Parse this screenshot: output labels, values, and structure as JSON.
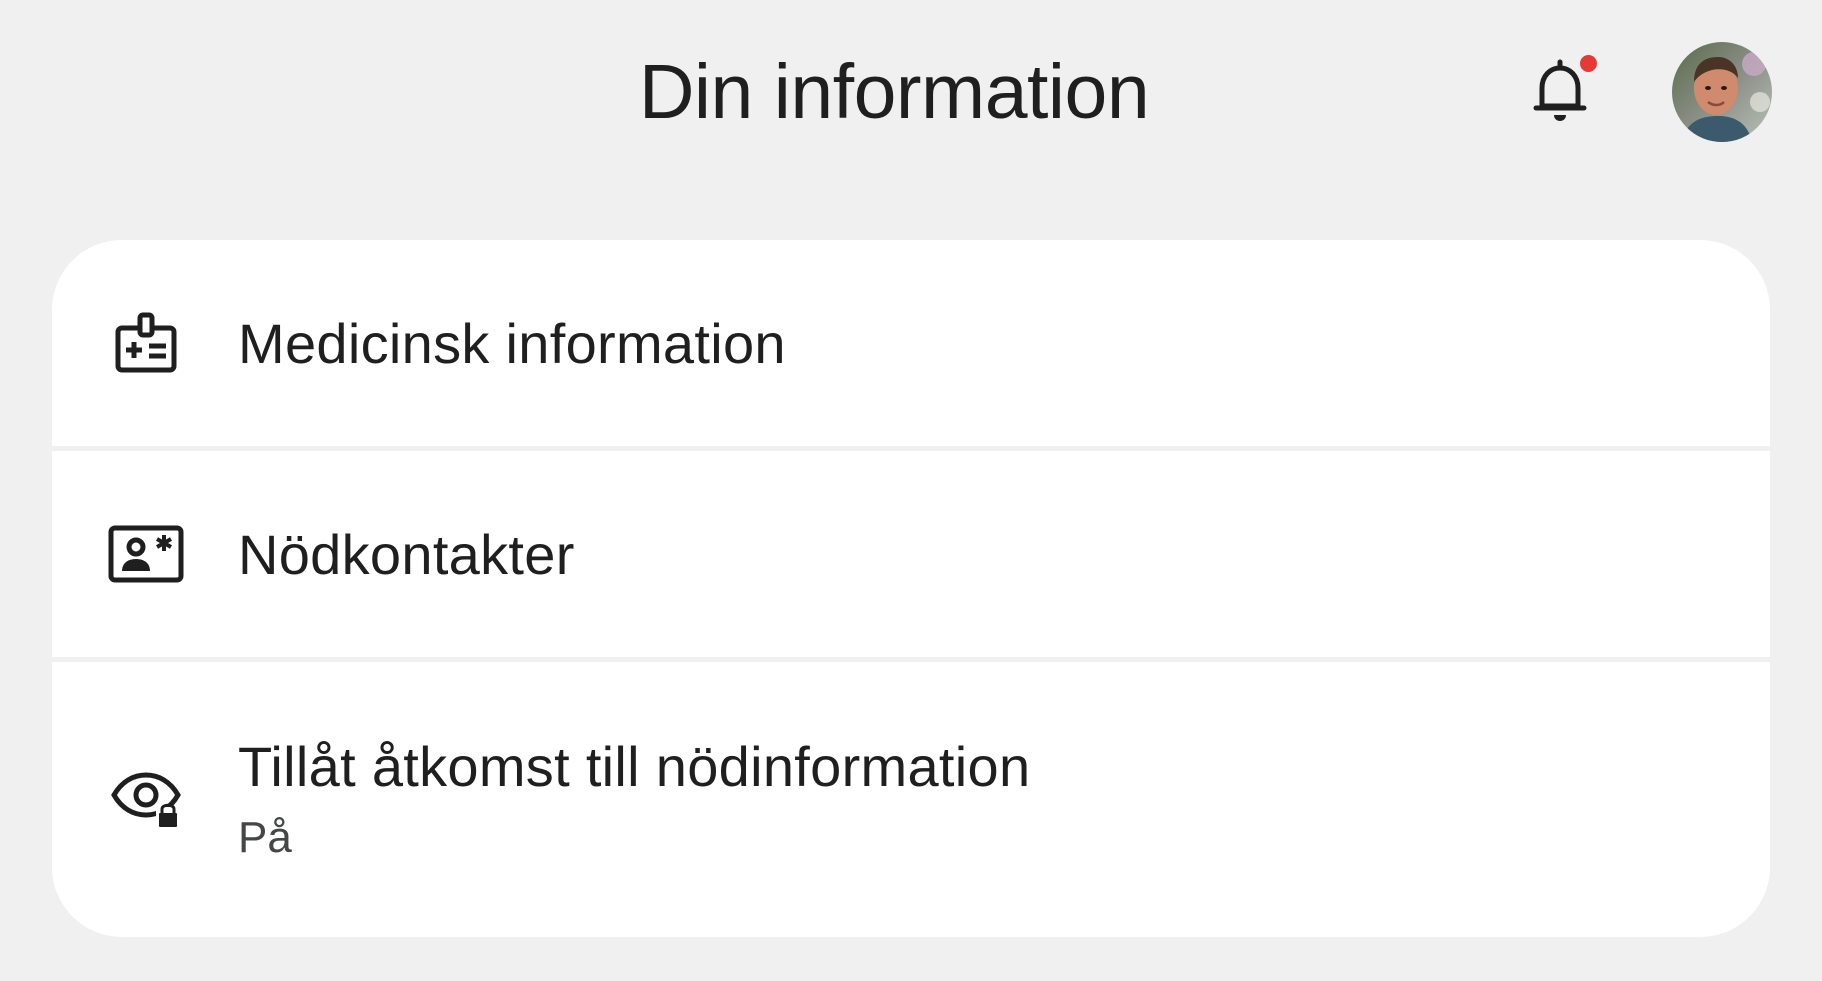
{
  "header": {
    "title": "Din information",
    "notifications_icon": "bell-icon",
    "notification_dot_color": "#e53935",
    "avatar_icon": "account-avatar"
  },
  "list": {
    "items": [
      {
        "label": "Medicinsk information",
        "icon": "medical-id-badge-icon"
      },
      {
        "label": "Nödkontakter",
        "icon": "emergency-contact-card-icon"
      },
      {
        "label": "Tillåt åtkomst till nödinformation",
        "sublabel": "På",
        "icon": "eye-lock-icon"
      }
    ]
  },
  "colors": {
    "background": "#f0f0f0",
    "card": "#ffffff",
    "text": "#1f1f1f",
    "secondary_text": "#444746"
  }
}
